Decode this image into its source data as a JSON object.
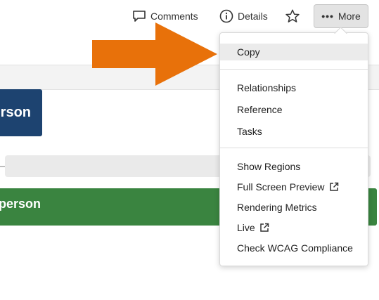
{
  "toolbar": {
    "comments_label": "Comments",
    "details_label": "Details",
    "more_label": "More"
  },
  "content": {
    "blue_button_text": "rson",
    "green_bar_text": "person"
  },
  "menu": {
    "items": [
      {
        "label": "Copy",
        "active": true
      },
      {
        "label": "Relationships"
      },
      {
        "label": "Reference"
      },
      {
        "label": "Tasks"
      },
      {
        "label": "Show Regions"
      },
      {
        "label": "Full Screen Preview",
        "icon": "external-link-icon"
      },
      {
        "label": "Rendering Metrics"
      },
      {
        "label": "Live",
        "icon": "external-link-icon"
      },
      {
        "label": "Check WCAG Compliance"
      }
    ]
  },
  "colors": {
    "arrow": "#e8710a",
    "blue_button": "#1d4370",
    "green_bar": "#3a8440",
    "menu_active": "#ebebeb"
  }
}
